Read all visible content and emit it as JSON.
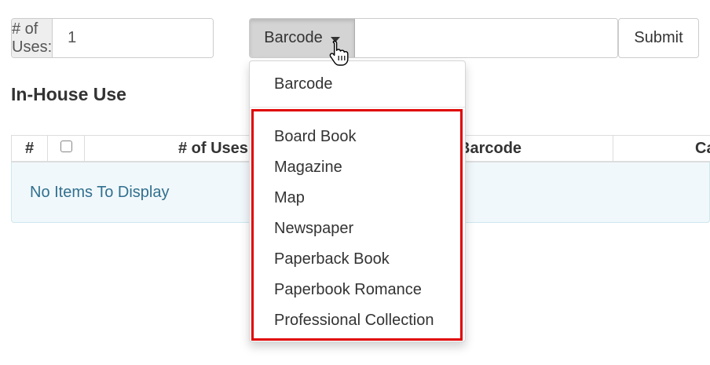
{
  "uses": {
    "label": "# of Uses:",
    "value": "1"
  },
  "search": {
    "type_label": "Barcode",
    "value": "",
    "submit_label": "Submit"
  },
  "section": {
    "title": "In-House Use"
  },
  "table": {
    "columns": [
      "#",
      "",
      "# of Uses",
      "Barcode",
      "Ca"
    ],
    "empty_message": "No Items To Display"
  },
  "dropdown": {
    "items": [
      "Barcode",
      "Board Book",
      "Magazine",
      "Map",
      "Newspaper",
      "Paperback Book",
      "Paperbook Romance",
      "Professional Collection"
    ],
    "highlight_color": "#e00000"
  },
  "colors": {
    "accent_text": "#31708f",
    "alert_bg": "#f1f8fb"
  }
}
